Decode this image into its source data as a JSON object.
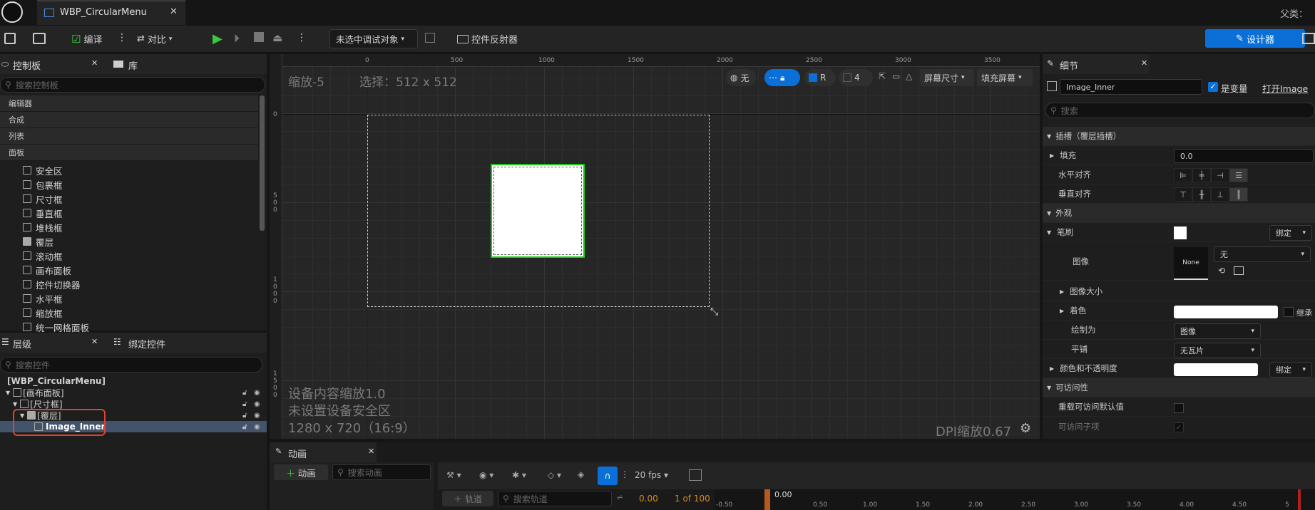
{
  "window": {
    "tab_title": "WBP_CircularMenu",
    "parent_label": "父类："
  },
  "toolbar": {
    "compile_label": "编译",
    "diff_label": "对比",
    "debug_object": "未选中调试对象",
    "widget_reflector": "控件反射器",
    "designer_label": "设计器"
  },
  "palette": {
    "tab_label": "控制板",
    "library_tab": "库",
    "search_placeholder": "搜索控制板",
    "categories": [
      "编辑器",
      "合成",
      "列表",
      "面板"
    ],
    "items": [
      "安全区",
      "包裹框",
      "尺寸框",
      "垂直框",
      "堆栈框",
      "覆层",
      "滚动框",
      "画布面板",
      "控件切换器",
      "水平框",
      "缩放框",
      "统一网格面板"
    ]
  },
  "hierarchy": {
    "tab_label": "层级",
    "bind_tab": "绑定控件",
    "search_placeholder": "搜索控件",
    "rows": [
      "[WBP_CircularMenu]",
      "[画布面板]",
      "[尺寸框]",
      "[覆层]",
      "Image_Inner"
    ]
  },
  "designer": {
    "zoom_text": "缩放-5",
    "selection_text": "选择：512 x 512",
    "world_none": "无",
    "r_label": "R",
    "grid_count": "4",
    "screen_size": "屏幕尺寸",
    "fill_screen": "填充屏幕",
    "device_scale": "设备内容缩放1.0",
    "safe_zone": "未设置设备安全区",
    "resolution": "1280 x 720（16:9）",
    "dpi_scale": "DPI缩放0.67",
    "ruler_x": [
      "0",
      "500",
      "1000",
      "1500",
      "2000",
      "2500",
      "3000",
      "3500"
    ],
    "ruler_y": [
      "0",
      "500",
      "1000",
      "1500"
    ]
  },
  "animation": {
    "tab_label": "动画",
    "add_button": "动画",
    "search_placeholder": "搜索动画",
    "track_button": "轨道",
    "track_search_placeholder": "搜索轨道",
    "fps": "20 fps",
    "current_time": "0.00",
    "frame_counter": "1 of 100",
    "playhead": "0.00",
    "timeline_ticks": [
      "-0.50",
      "0.50",
      "1.00",
      "1.50",
      "2.00",
      "2.50",
      "3.00",
      "3.50",
      "4.00",
      "4.50",
      "5"
    ]
  },
  "details": {
    "tab_label": "细节",
    "name_value": "Image_Inner",
    "is_variable_label": "是变量",
    "open_image_link": "打开Image",
    "search_placeholder": "搜索",
    "slot_category": "插槽（覆层插槽）",
    "padding_label": "填充",
    "padding_value": "0.0",
    "h_align_label": "水平对齐",
    "v_align_label": "垂直对齐",
    "appearance_category": "外观",
    "brush_label": "笔刷",
    "bind_label": "绑定",
    "image_label": "图像",
    "image_thumb": "None",
    "image_value": "无",
    "image_size_label": "图像大小",
    "tint_label": "着色",
    "inherit_label": "继承",
    "draw_as_label": "绘制为",
    "draw_as_value": "图像",
    "tiling_label": "平铺",
    "tiling_value": "无瓦片",
    "color_opacity_label": "颜色和不透明度",
    "bind_label2": "绑定",
    "accessibility_category": "可访问性",
    "override_access_label": "重载可访问默认值",
    "access_children_label": "可访问子项"
  },
  "colors": {
    "accent": "#0a70d8",
    "selection_green": "#14c814",
    "highlight_red": "#e0442c"
  }
}
